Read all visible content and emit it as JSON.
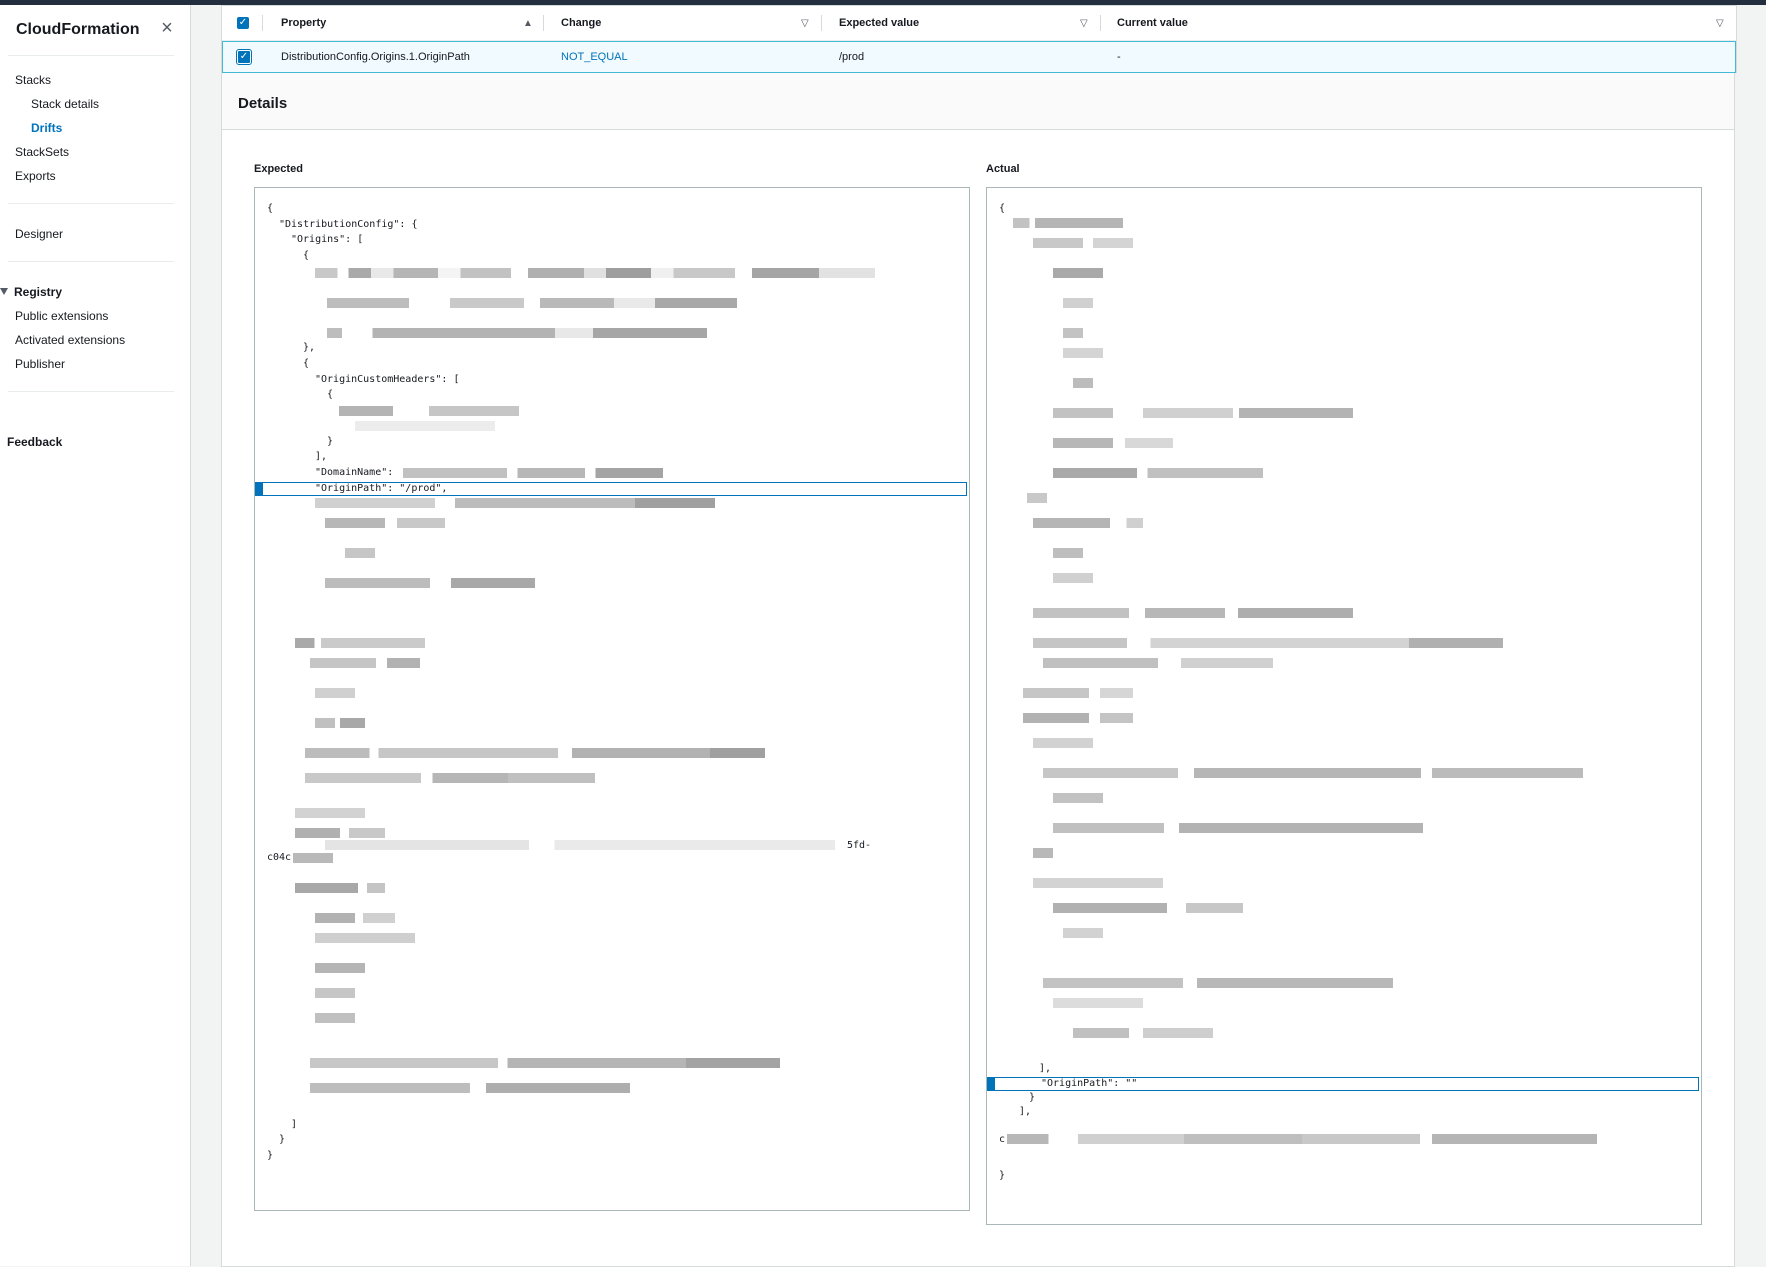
{
  "sidebar": {
    "title": "CloudFormation",
    "close_icon": "×",
    "items": {
      "stacks": "Stacks",
      "stack_details": "Stack details",
      "drifts": "Drifts",
      "stacksets": "StackSets",
      "exports": "Exports",
      "designer": "Designer",
      "registry": "Registry",
      "public_extensions": "Public extensions",
      "activated_extensions": "Activated extensions",
      "publisher": "Publisher",
      "feedback": "Feedback"
    }
  },
  "table": {
    "columns": {
      "property": "Property",
      "change": "Change",
      "expected": "Expected value",
      "current": "Current value"
    },
    "sort_asc_icon": "▲",
    "filter_icon": "▽",
    "check": "✓",
    "row": {
      "property": "DistributionConfig.Origins.1.OriginPath",
      "change": "NOT_EQUAL",
      "expected": "/prod",
      "current": "-"
    }
  },
  "details": {
    "title": "Details",
    "expected_label": "Expected",
    "actual_label": "Actual",
    "expected_lines": {
      "l1": "{",
      "l2": "\"DistributionConfig\": {",
      "l3": "\"Origins\": [",
      "l4": "{",
      "l5": "},",
      "l6": "{",
      "l7": "\"OriginCustomHeaders\": [",
      "l8": "{",
      "l9": "}",
      "l10": "],",
      "l11": "\"DomainName\":",
      "l12": "\"OriginPath\": \"/prod\",",
      "l13": "5fd-",
      "l14": "c04c",
      "l15": "]",
      "l16": "}",
      "l17": "}"
    },
    "actual_lines": {
      "l1": "{",
      "l2": "],",
      "l3": "\"OriginPath\": \"\"",
      "l4": "}",
      "l5": "],",
      "l6": "c",
      "l7": "}"
    }
  }
}
